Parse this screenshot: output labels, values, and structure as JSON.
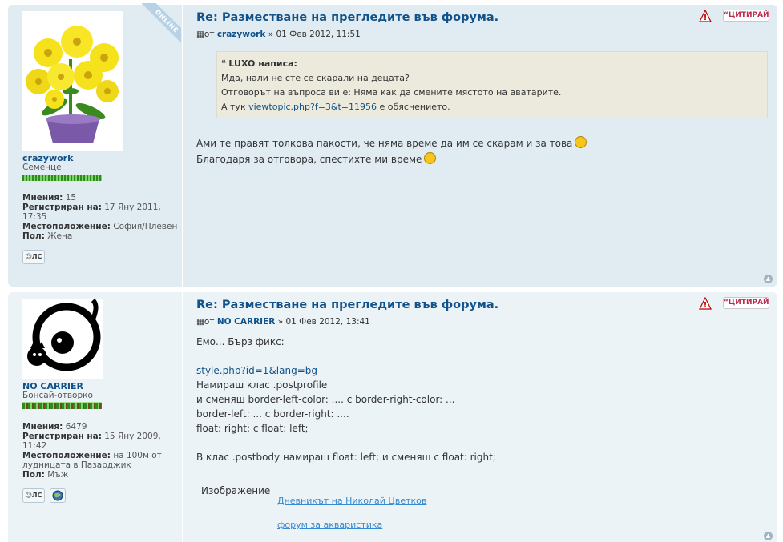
{
  "posts": [
    {
      "author": "crazywork",
      "online_badge": "ONLINE",
      "rank": "Семенце",
      "stats": {
        "posts_label": "Мнения:",
        "posts_value": "15",
        "joined_label": "Регистриран на:",
        "joined_value": "17 Яну 2011, 17:35",
        "location_label": "Местоположение:",
        "location_value": "София/Плевен",
        "gender_label": "Пол:",
        "gender_value": "Жена"
      },
      "pm_label": "ЛС",
      "title": "Re: Разместване на прегледите във форума.",
      "meta_prefix": "от",
      "meta_date": "» 01 Фев 2012, 11:51",
      "report_glyph": "!",
      "quote_label": "ЦИТИРАЙ",
      "quote": {
        "cite": "LUXO написа:",
        "lines": [
          "Мда, нали не сте се скарали на децата?",
          "Отговорът на въпроса ви е: Няма как да смените мястото на аватарите."
        ],
        "line3_prefix": "А тук",
        "line3_link": "viewtopic.php?f=3&t=11956",
        "line3_suffix": "е обяснението."
      },
      "content": [
        "Ами те правят толкова пакости, че няма време да им се скарам и за това",
        "Благодаря за отговора, спестихте ми време"
      ]
    },
    {
      "author": "NO CARRIER",
      "rank": "Бонсай-отворко",
      "stats": {
        "posts_label": "Мнения:",
        "posts_value": "6479",
        "joined_label": "Регистриран на:",
        "joined_value": "15 Яну 2009, 11:42",
        "location_label": "Местоположение:",
        "location_value": "на 100м от лудницата в Пазарджик",
        "gender_label": "Пол:",
        "gender_value": "Мъж"
      },
      "pm_label": "ЛС",
      "title": "Re: Разместване на прегледите във форума.",
      "meta_prefix": "от",
      "meta_date": "» 01 Фев 2012, 13:41",
      "report_glyph": "!",
      "quote_label": "ЦИТИРАЙ",
      "content": [
        "Емо... Бърз фикс:",
        "",
        "style.php?id=1&lang=bg",
        "Намираш клас .postprofile",
        "и сменяш border-left-color: .... с border-right-color: ...",
        "border-left: ... с border-right: ....",
        "float: right; с float: left;",
        "",
        "В клас .postbody намираш float: left; и сменяш с float: right;"
      ],
      "signature": {
        "image_alt": "Изображение",
        "links": [
          "Дневникът на Николай Цветков",
          "форум за аквариcтика"
        ]
      }
    }
  ],
  "icons": {
    "post_icon": "post-file-icon",
    "top_icon": "back-to-top-icon",
    "smileys": [
      "sad-smiley-icon",
      "happy-smiley-icon"
    ],
    "website_icon": "globe-icon"
  },
  "colors": {
    "post_bg_1": "#e1ebf2",
    "post_bg_2": "#ecf3f7",
    "link": "#105289",
    "quote_bg": "#ebeadd",
    "quote_btn_text": "#bc2a4d"
  }
}
